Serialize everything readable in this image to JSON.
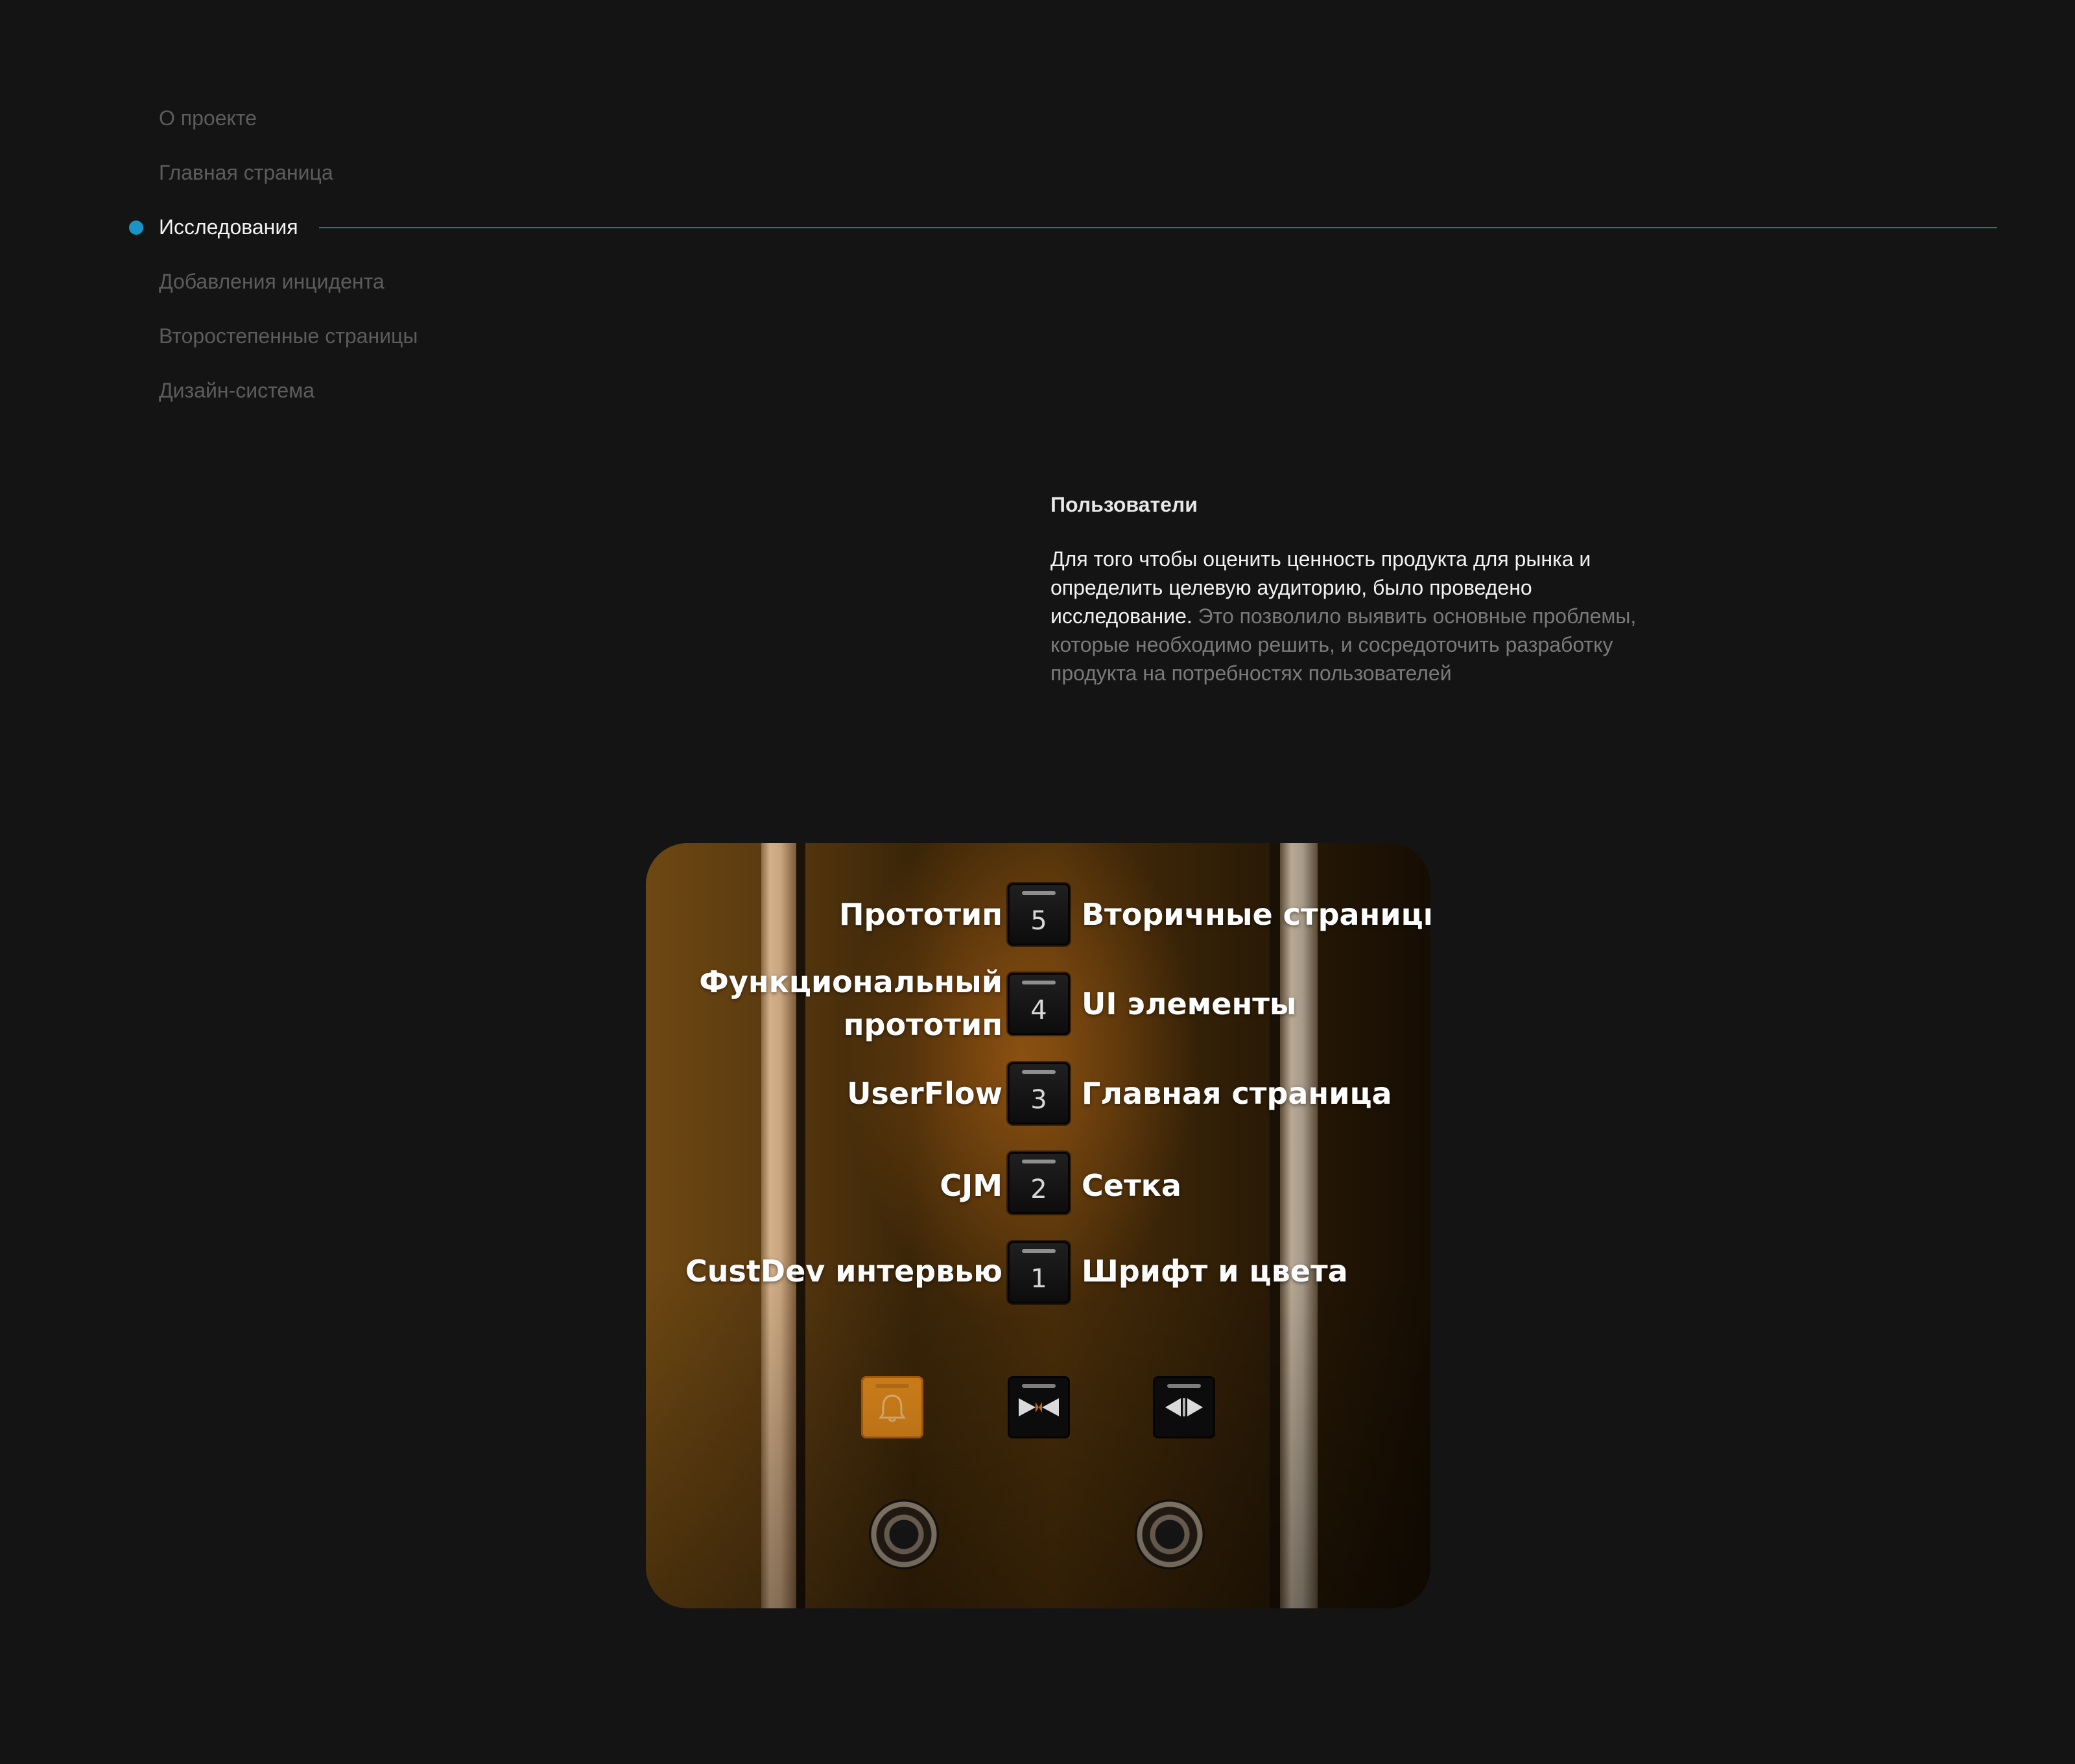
{
  "nav": {
    "items": [
      {
        "label": "О проекте"
      },
      {
        "label": "Главная страница"
      },
      {
        "label": "Исследования"
      },
      {
        "label": "Добавления инцидента"
      },
      {
        "label": "Второстепенные страницы"
      },
      {
        "label": "Дизайн-система"
      }
    ],
    "active_index": 2,
    "accent_color": "#1a93c7"
  },
  "section": {
    "title": "Пользователи",
    "lead": "Для того чтобы оценить ценность продукта для рынка и определить целевую аудиторию, было проведено исследование.",
    "rest": " Это позволило выявить основные проблемы, которые необходимо решить, и сосредоточить разработку продукта на потребностях пользователей"
  },
  "panel": {
    "floors": [
      {
        "number": "5",
        "left": "Прототип",
        "right": "Вторичные страницы"
      },
      {
        "number": "4",
        "left_line1": "Функциональный",
        "left_line2": "прототип",
        "right": "UI элементы"
      },
      {
        "number": "3",
        "left": "UserFlow",
        "right": "Главная страница"
      },
      {
        "number": "2",
        "left": "CJM",
        "right": "Сетка"
      },
      {
        "number": "1",
        "left": "CustDev интервью",
        "right": "Шрифт и цвета"
      }
    ],
    "controls": [
      "bell-icon",
      "door-open-icon",
      "door-close-icon"
    ],
    "alarm_color": "#e38b1c"
  }
}
